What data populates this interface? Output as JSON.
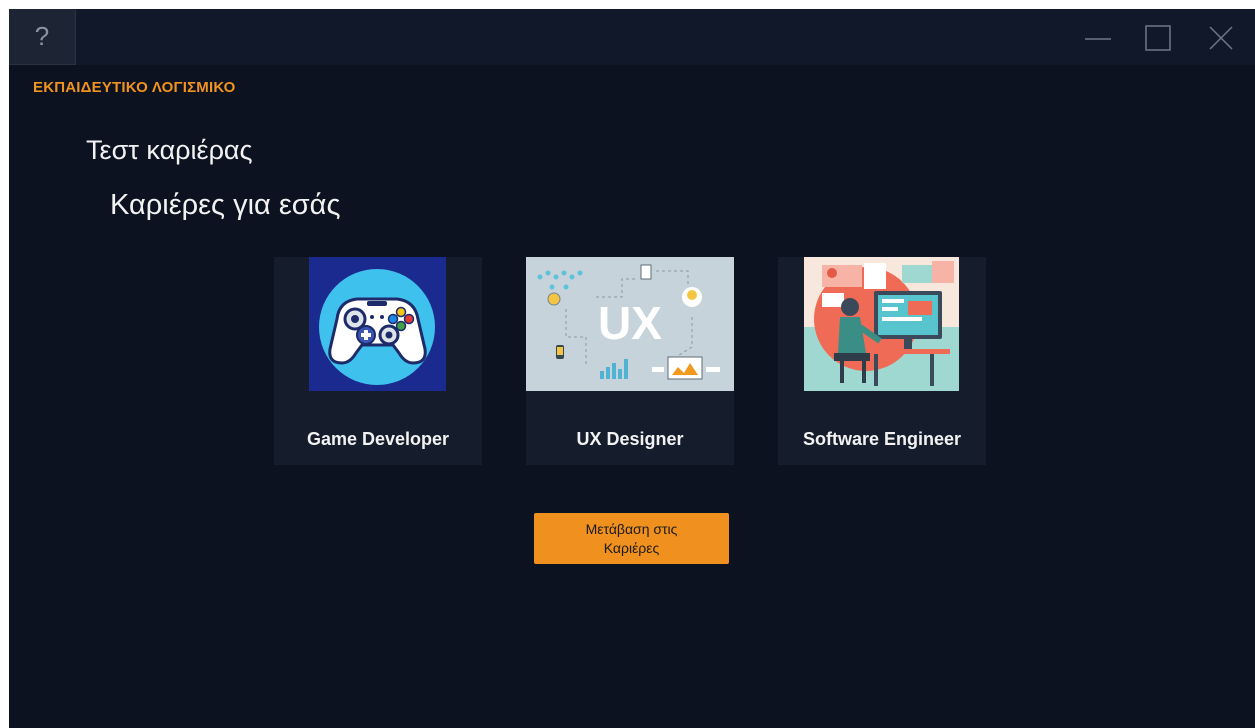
{
  "window": {
    "help_glyph": "?",
    "controls": [
      "minimize-icon",
      "maximize-icon",
      "close-icon"
    ]
  },
  "app_label": "ΕΚΠΑΙΔΕΥΤΙΚΟ ΛΟΓΙΣΜΙΚΟ",
  "page_title": "Τεστ καριέρας",
  "page_subtitle": "Καριέρες για εσάς",
  "careers": [
    {
      "label": "Game Developer",
      "image": "game-controller-image"
    },
    {
      "label": "UX Designer",
      "image": "ux-flow-image"
    },
    {
      "label": "Software Engineer",
      "image": "developer-at-desk-image"
    }
  ],
  "go_button": {
    "label": "Μετάβαση στις Καριέρες"
  },
  "colors": {
    "background": "#0d1220",
    "titlebar": "#11182a",
    "card": "#151c2c",
    "accent": "#f0901e",
    "text": "#f2f2f2"
  }
}
